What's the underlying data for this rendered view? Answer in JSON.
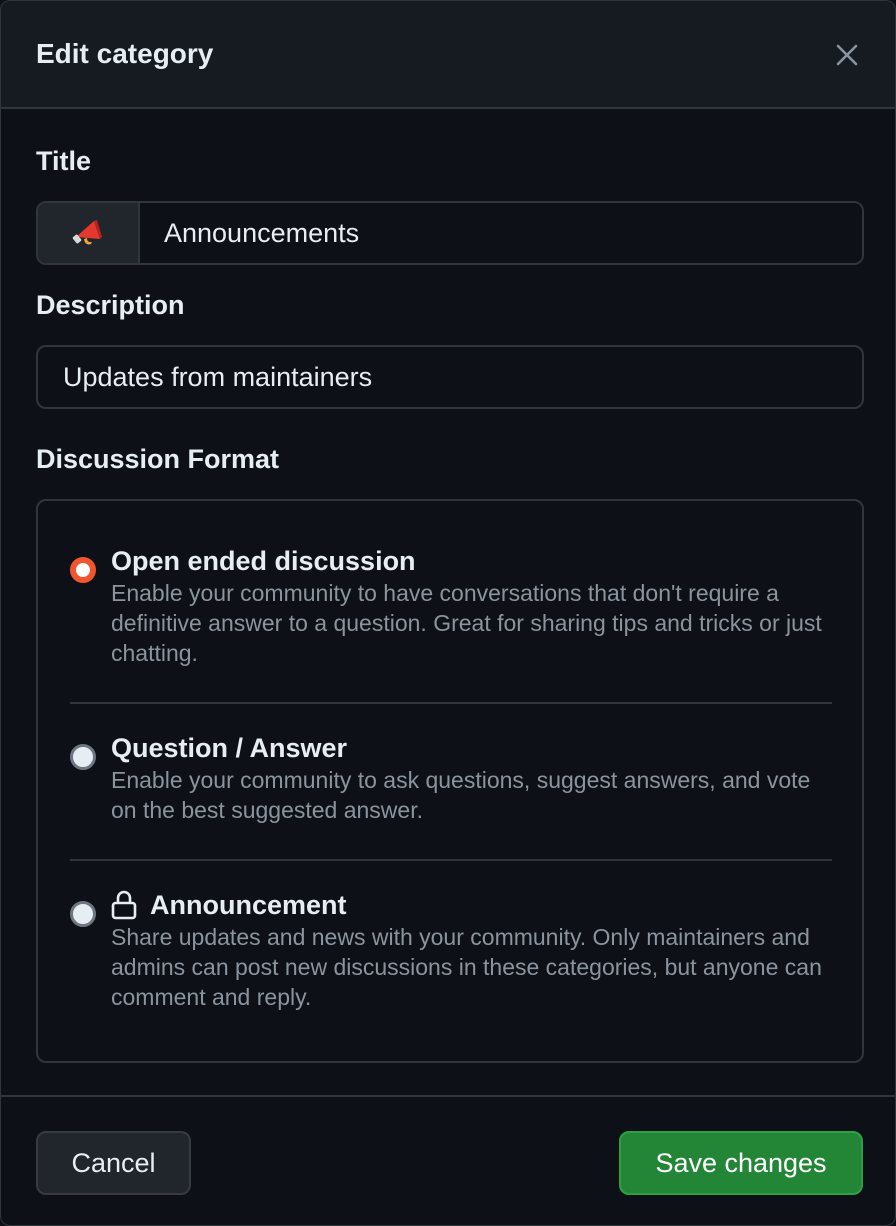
{
  "dialog": {
    "title": "Edit category"
  },
  "form": {
    "title_label": "Title",
    "title_value": "Announcements",
    "title_emoji": "megaphone-emoji",
    "description_label": "Description",
    "description_value": "Updates from maintainers",
    "format_label": "Discussion Format"
  },
  "formats": [
    {
      "title": "Open ended discussion",
      "description": "Enable your community to have conversations that don't require a definitive answer to a question. Great for sharing tips and tricks or just chatting.",
      "selected": true
    },
    {
      "title": "Question / Answer",
      "description": "Enable your community to ask questions, suggest answers, and vote on the best suggested answer.",
      "selected": false
    },
    {
      "title": "Announcement",
      "description": "Share updates and news with your community. Only maintainers and admins can post new discussions in these categories, but anyone can comment and reply.",
      "selected": false,
      "icon": "lock-icon"
    }
  ],
  "footer": {
    "cancel_label": "Cancel",
    "save_label": "Save changes"
  },
  "colors": {
    "background": "#0d1117",
    "header_background": "#161b22",
    "border": "#30363d",
    "radio_checked": "#f0552e",
    "save_button": "#238636",
    "muted_text": "#8b949e"
  }
}
